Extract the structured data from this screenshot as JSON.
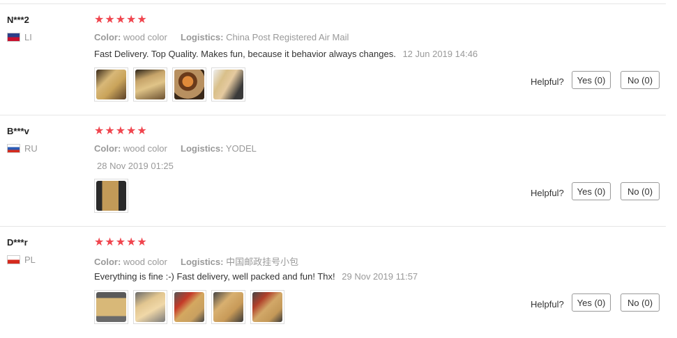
{
  "labels": {
    "color": "Color:",
    "logistics": "Logistics:",
    "helpful": "Helpful?",
    "yes": "Yes (0)",
    "no": "No (0)"
  },
  "colors": {
    "star": "#f0454e",
    "muted_text": "#999999",
    "body_text": "#333333",
    "divider": "#e6e6e6"
  },
  "reviews": [
    {
      "user": "N***2",
      "country": "LI",
      "flag_icon": "flag-liechtenstein-icon",
      "rating": 5,
      "stars": "★★★★★",
      "color": "wood color",
      "logistics": "China Post Registered Air Mail",
      "text": "Fast Delivery. Top Quality. Makes fun, because it behavior always changes.",
      "date": "12 Jun 2019 14:46",
      "photo_count": 4
    },
    {
      "user": "B***v",
      "country": "RU",
      "flag_icon": "flag-russia-icon",
      "rating": 5,
      "stars": "★★★★★",
      "color": "wood color",
      "logistics": "YODEL",
      "text": "",
      "date": "28 Nov 2019 01:25",
      "photo_count": 1
    },
    {
      "user": "D***r",
      "country": "PL",
      "flag_icon": "flag-poland-icon",
      "rating": 5,
      "stars": "★★★★★",
      "color": "wood color",
      "logistics": "中国邮政挂号小包",
      "text": "Everything is fine :-) Fast delivery, well packed and fun! Thx!",
      "date": "29 Nov 2019 11:57",
      "photo_count": 5
    }
  ]
}
